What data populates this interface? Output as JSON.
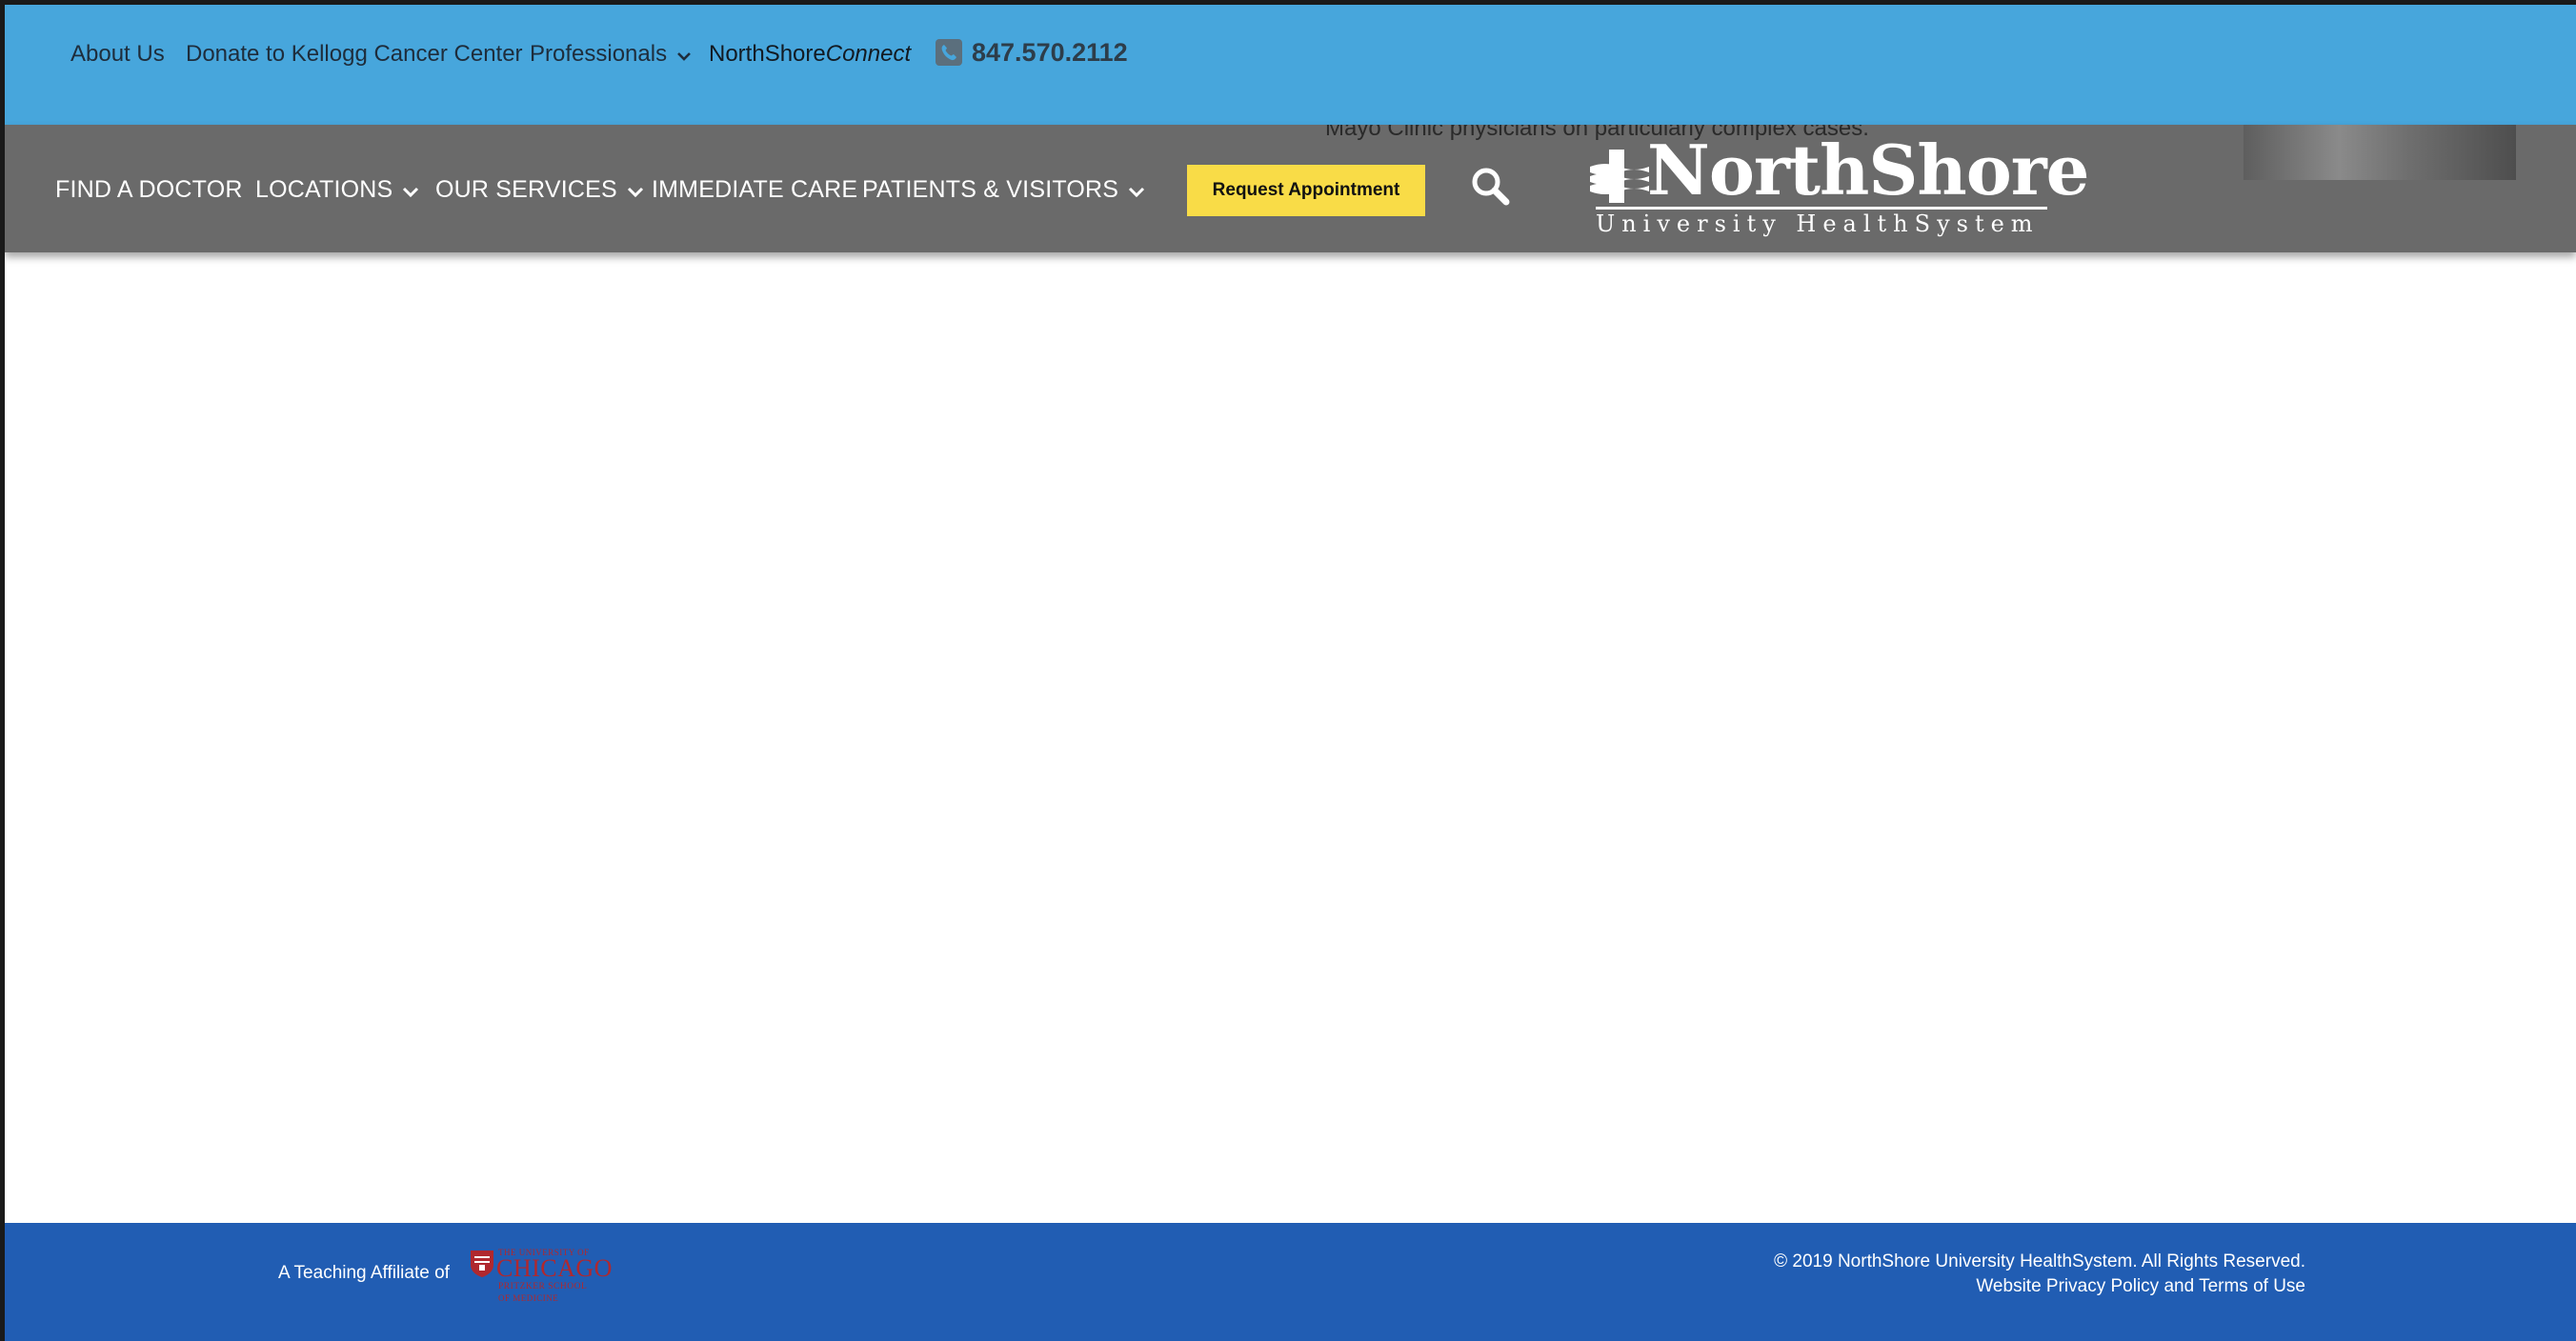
{
  "utility_nav": {
    "about": "About Us",
    "donate": "Donate to Kellogg Cancer Center",
    "professionals": "Professionals",
    "connect_prefix": "NorthShore",
    "connect_suffix": "Connect",
    "phone": "847.570.2112"
  },
  "main_nav": {
    "find_doctor": "FIND A DOCTOR",
    "locations": "LOCATIONS",
    "services": "OUR SERVICES",
    "immediate_care": "IMMEDIATE CARE",
    "patients_visitors": "PATIENTS & VISITORS",
    "request_button": "Request Appointment"
  },
  "background_snippet": "Mayo Clinic physicians on particularly complex cases.",
  "logo": {
    "name": "NorthShore",
    "subtitle": "University HealthSystem"
  },
  "footer": {
    "affiliate_text": "A Teaching Affiliate of",
    "uchicago": {
      "line1": "THE UNIVERSITY OF",
      "line2": "CHICAGO",
      "line3": "PRITZKER SCHOOL",
      "line4": "OF MEDICINE"
    },
    "copyright": "© 2019 NorthShore University HealthSystem. All Rights Reserved.",
    "policy_link": "Website Privacy Policy and Terms of Use"
  },
  "colors": {
    "utility_bar": "#47a6dc",
    "nav_bar": "#6a6a6a",
    "request_button": "#f9dc47",
    "footer": "#215db3",
    "uchicago_red": "#b0282e"
  }
}
